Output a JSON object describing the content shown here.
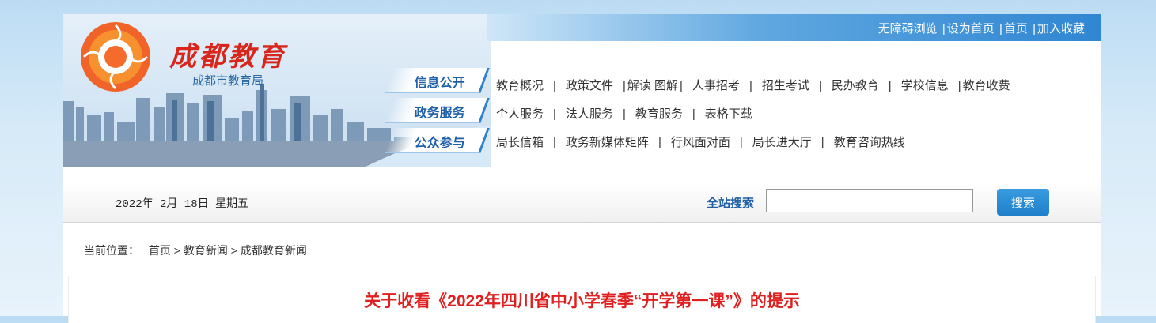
{
  "site": {
    "logo_title": "成都教育",
    "logo_subtitle": "成都市教育局"
  },
  "top_links": [
    "无障碍浏览",
    "设为首页",
    "首页",
    "加入收藏"
  ],
  "nav_labels": [
    "信息公开",
    "政务服务",
    "公众参与"
  ],
  "nav_rows": [
    [
      "教育概况",
      "政策文件",
      "解读  图解",
      "人事招考",
      "招生考试",
      "民办教育",
      "学校信息",
      "教育收费"
    ],
    [
      "个人服务",
      "法人服务",
      "教育服务",
      "表格下载"
    ],
    [
      "局长信箱",
      "政务新媒体矩阵",
      "行风面对面",
      "局长进大厅",
      "教育咨询热线"
    ]
  ],
  "date": "2022年  2月  18日  星期五",
  "search": {
    "label": "全站搜索",
    "placeholder": "",
    "button": "搜索"
  },
  "breadcrumb": {
    "prefix": "当前位置：",
    "items": [
      "首页",
      "教育新闻",
      "成都教育新闻"
    ],
    "separator": ">"
  },
  "article": {
    "title": "关于收看《2022年四川省中小学春季“开学第一课”》的提示"
  },
  "colors": {
    "accent_blue": "#2e7fd0",
    "title_red": "#e02020",
    "logo_red": "#d9261c"
  }
}
